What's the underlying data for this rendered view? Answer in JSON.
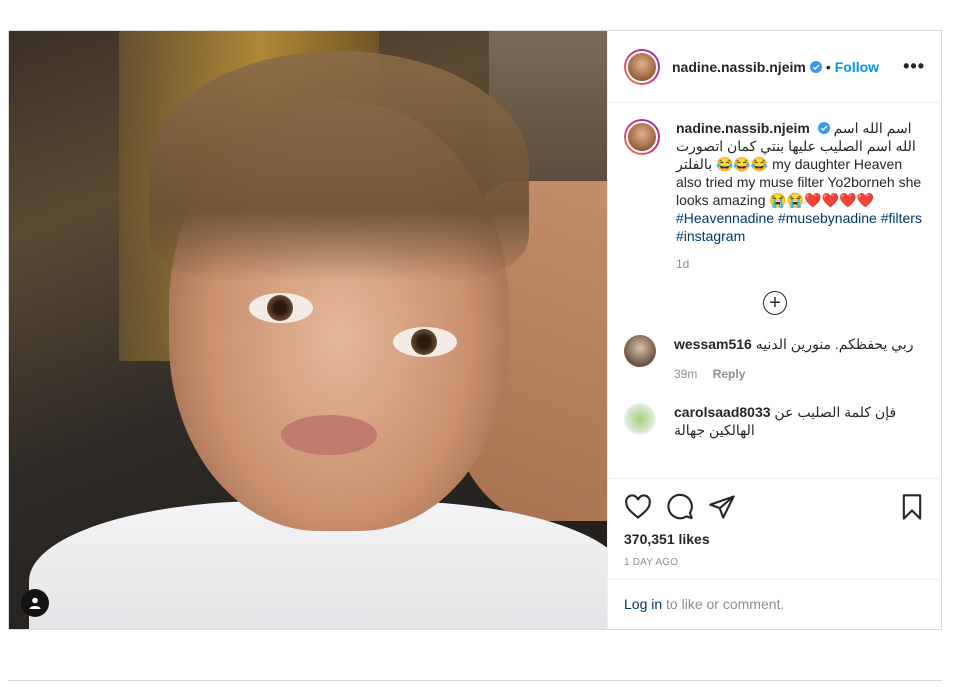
{
  "post": {
    "username": "nadine.nassib.njeim",
    "follow_label": "Follow",
    "dot": "•",
    "more_label": "•••",
    "caption_text": "اسم الله اسم الله اسم الصليب عليها بنتي كمان اتصورت بالفلتر 😂😂😂 my daughter Heaven also tried my muse filter Yo2borneh she looks amazing 😭😭❤️❤️❤️❤️",
    "hashtags": "#Heavennadine #musebynadine #filters #instagram",
    "caption_time": "1d",
    "load_more_symbol": "+"
  },
  "comments": [
    {
      "username": "wessam516",
      "text": "ربي يحفظكم. منورين الدنيه",
      "time": "39m",
      "reply_label": "Reply"
    },
    {
      "username": "carolsaad8033",
      "text": "فإن كلمة الصليب عن الهالكين جهالة"
    }
  ],
  "actions": {
    "likes": "370,351 likes",
    "ago": "1 DAY AGO",
    "login_link": "Log in",
    "login_suffix": " to like or comment."
  },
  "icons": {
    "verified": "verified-badge-icon",
    "like": "heart-icon",
    "comment": "comment-bubble-icon",
    "share": "paper-plane-icon",
    "save": "bookmark-icon",
    "user_tag": "user-tag-icon"
  },
  "colors": {
    "link_blue": "#0095f6",
    "hashtag": "#00376b",
    "muted": "#8e8e8e"
  }
}
